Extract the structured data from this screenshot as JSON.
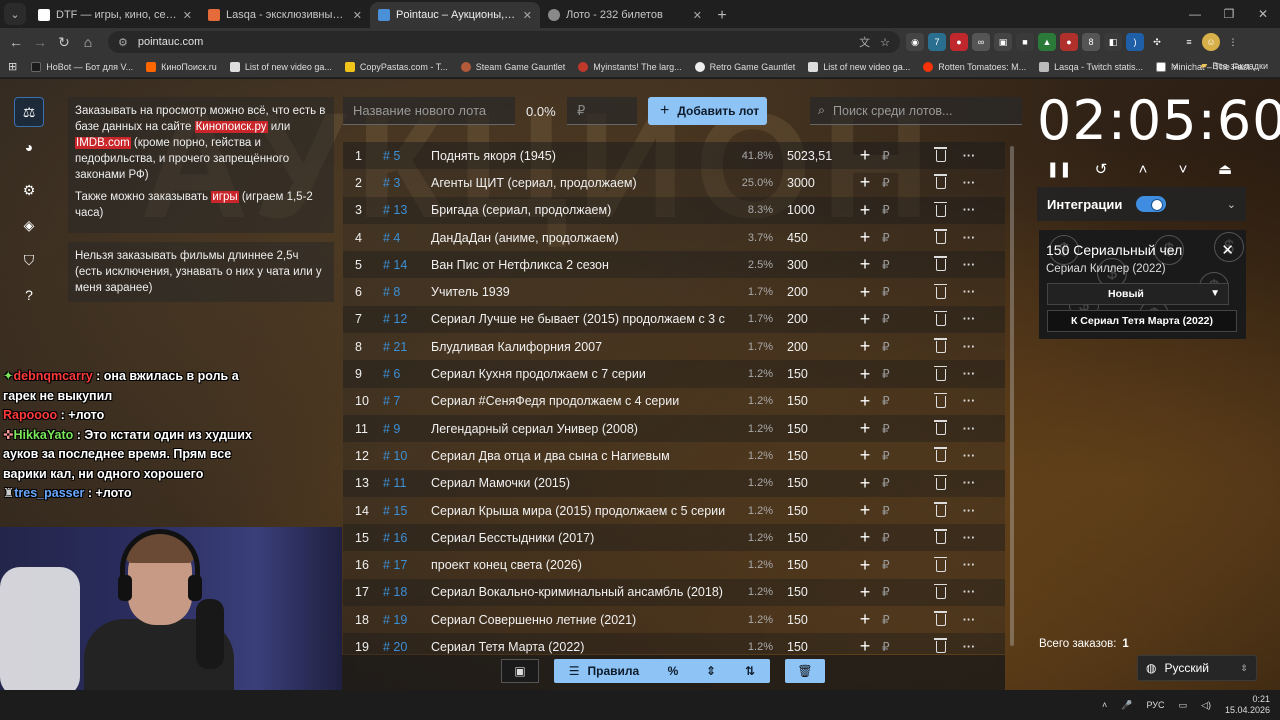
{
  "browser": {
    "tabs": [
      {
        "title": "DTF — игры, кино, сериалы, р",
        "color": "#ffffff"
      },
      {
        "title": "Lasqa - эксклюзивный контен",
        "color": "#e66b3b"
      },
      {
        "title": "Pointauc – Аукционы, лотерея",
        "color": "#4a90d9"
      },
      {
        "title": "Лото - 232 билетов",
        "color": "#8a8a8a"
      }
    ],
    "url": "pointauc.com",
    "bookmarks": [
      {
        "label": "HoBot — Бот для V...",
        "color": "#1a1a1a"
      },
      {
        "label": "КиноПоиск.ru",
        "color": "#ff6600"
      },
      {
        "label": "List of new video ga...",
        "color": "#dddddd"
      },
      {
        "label": "CopyPastas.com - T...",
        "color": "#f0c419"
      },
      {
        "label": "Steam Game Gauntlet",
        "color": "#b35a3a"
      },
      {
        "label": "Myinstants! The larg...",
        "color": "#c0392b"
      },
      {
        "label": "Retro Game Gauntlet",
        "color": "#eeeeee"
      },
      {
        "label": "List of new video ga...",
        "color": "#dddddd"
      },
      {
        "label": "Rotten Tomatoes: M...",
        "color": "#fa320a"
      },
      {
        "label": "Lasqa - Twitch statis...",
        "color": "#bbbbbb"
      },
      {
        "label": "Minichat – The Fast...",
        "color": "#ffffff"
      }
    ],
    "all_bookmarks": "Все закладки"
  },
  "sidebar": {
    "icons": [
      "auction-icon",
      "pie-chart-icon",
      "settings-icon",
      "layers-icon",
      "shield-icon",
      "help-icon"
    ]
  },
  "info": {
    "p1_a": "Заказывать на просмотр можно всё, что есть в базе данных на сайте ",
    "p1_link1": "Кинопоиск.ру",
    "p1_b": " или ",
    "p1_link2": "IMDB.com",
    "p1_c": " (кроме порно, гейства и педофильства, и прочего запрещённого законами РФ)",
    "p2_a": "Также можно заказывать ",
    "p2_link": "игры",
    "p2_b": " (играем 1,5-2 часа)",
    "p3": "Нельзя заказывать фильмы длиннее 2,5ч (есть исключения, узнавать о них у чата или у меня заранее)"
  },
  "chat": [
    {
      "user": "debnqmcarry",
      "sep": " : ",
      "text": "она вжилась в роль а гарек не выкупил",
      "user_color": "#ff3a3a"
    },
    {
      "user": "Rapoooo",
      "sep": " : ",
      "text": "+лото",
      "user_color": "#ff3a3a"
    },
    {
      "user": "HikkaYato",
      "sep": " : ",
      "text": "Это кстати один из худших ауков за последнее время. Прям все варики кал, ни одного хорошего",
      "user_color": "#7be65a"
    },
    {
      "user": "tres_passer",
      "sep": " : ",
      "text": "+лото",
      "user_color": "#6aa8ff"
    }
  ],
  "controls": {
    "new_lot_placeholder": "Название нового лота",
    "percent": "0.0%",
    "price_placeholder": "₽",
    "add_button": "Добавить лот",
    "search_placeholder": "Поиск среди лотов..."
  },
  "lots": [
    {
      "n": "1",
      "id": "# 5",
      "name": "Поднять якоря (1945)",
      "pct": "41.8%",
      "amount": "5023,51"
    },
    {
      "n": "2",
      "id": "# 3",
      "name": "Агенты ЩИТ (сериал, продолжаем)",
      "pct": "25.0%",
      "amount": "3000"
    },
    {
      "n": "3",
      "id": "# 13",
      "name": "Бригада (сериал, продолжаем)",
      "pct": "8.3%",
      "amount": "1000"
    },
    {
      "n": "4",
      "id": "# 4",
      "name": "ДанДаДан (аниме, продолжаем)",
      "pct": "3.7%",
      "amount": "450"
    },
    {
      "n": "5",
      "id": "# 14",
      "name": "Ван Пис от Нетфликса 2 сезон",
      "pct": "2.5%",
      "amount": "300"
    },
    {
      "n": "6",
      "id": "# 8",
      "name": "Учитель 1939",
      "pct": "1.7%",
      "amount": "200"
    },
    {
      "n": "7",
      "id": "# 12",
      "name": "Сериал Лучше не бывает (2015) продолжаем с 3 с",
      "pct": "1.7%",
      "amount": "200"
    },
    {
      "n": "8",
      "id": "# 21",
      "name": "Блудливая Калифорния 2007",
      "pct": "1.7%",
      "amount": "200"
    },
    {
      "n": "9",
      "id": "# 6",
      "name": "Сериал Кухня продолжаем с 7 серии",
      "pct": "1.2%",
      "amount": "150"
    },
    {
      "n": "10",
      "id": "# 7",
      "name": "Сериал #СеняФедя продолжаем с 4 серии",
      "pct": "1.2%",
      "amount": "150"
    },
    {
      "n": "11",
      "id": "# 9",
      "name": "Легендарный сериал Универ (2008)",
      "pct": "1.2%",
      "amount": "150"
    },
    {
      "n": "12",
      "id": "# 10",
      "name": "Сериал Два отца и два сына с Нагиевым",
      "pct": "1.2%",
      "amount": "150"
    },
    {
      "n": "13",
      "id": "# 11",
      "name": "Сериал Мамочки (2015)",
      "pct": "1.2%",
      "amount": "150"
    },
    {
      "n": "14",
      "id": "# 15",
      "name": "Сериал Крыша мира (2015) продолжаем с 5 серии",
      "pct": "1.2%",
      "amount": "150"
    },
    {
      "n": "15",
      "id": "# 16",
      "name": "Сериал Бесстыдники (2017)",
      "pct": "1.2%",
      "amount": "150"
    },
    {
      "n": "16",
      "id": "# 17",
      "name": "проект конец света (2026)",
      "pct": "1.2%",
      "amount": "150"
    },
    {
      "n": "17",
      "id": "# 18",
      "name": "Сериал Вокально-криминальный ансамбль (2018)",
      "pct": "1.2%",
      "amount": "150"
    },
    {
      "n": "18",
      "id": "# 19",
      "name": "Сериал Совершенно летние (2021)",
      "pct": "1.2%",
      "amount": "150"
    },
    {
      "n": "19",
      "id": "# 20",
      "name": "Сериал Тетя Марта (2022)",
      "pct": "1.2%",
      "amount": "150"
    }
  ],
  "row_currency": "₽",
  "bottombar": {
    "rules_label": "Правила",
    "percent_symbol": "%"
  },
  "timer": {
    "value": "02:05:60"
  },
  "integrations": {
    "label": "Интеграции",
    "enabled": true
  },
  "card": {
    "title": "150 Сериальный чел",
    "subtitle": "Сериал Киллер (2022)",
    "status": "Новый",
    "action": "К Сериал Тетя Марта (2022)"
  },
  "footer": {
    "orders_label": "Всего заказов:",
    "orders_count": "1",
    "language": "Русский"
  },
  "taskbar": {
    "lang": "РУС",
    "time": "0:21",
    "date": "15.04.2026"
  }
}
